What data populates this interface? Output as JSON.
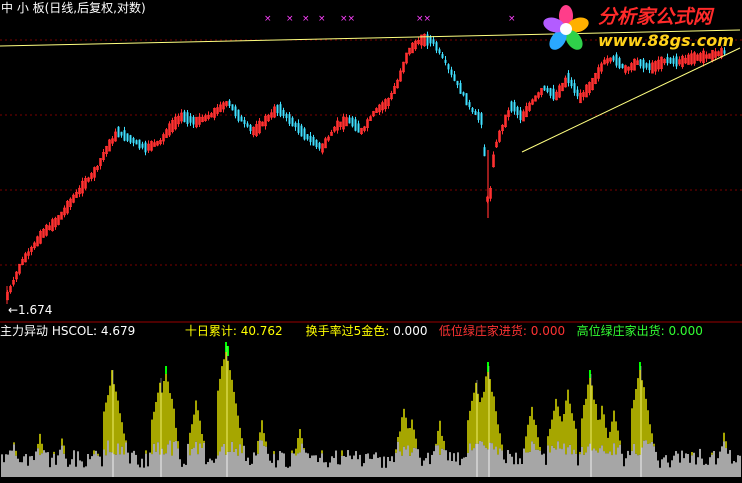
{
  "header": {
    "title": "中 小 板(日线,后复权,对数)"
  },
  "price_panel": {
    "low_label": "←1.674",
    "top_markers": [
      "×",
      "×",
      "×",
      "×",
      "××",
      "××",
      "×"
    ]
  },
  "indicator_panel": {
    "name": "主力异动",
    "items": [
      {
        "label": "HSCOL:",
        "value": "4.679",
        "color": "#ffffff"
      },
      {
        "label": "十日累计:",
        "value": "40.762",
        "color": "#ffff00"
      },
      {
        "label": "换手率过5金色:",
        "value": "0.000",
        "color": "#ffff00"
      },
      {
        "label": "低位绿庄家进货:",
        "value": "0.000",
        "color": "#ff3333"
      },
      {
        "label": "高位绿庄家出货:",
        "value": "0.000",
        "color": "#33ff33"
      }
    ]
  },
  "logo": {
    "line1": "分析家公式网",
    "line2": "www.88gs.com"
  },
  "colors": {
    "up": "#ff3030",
    "down": "#40e0ff",
    "grid": "#7a0000",
    "trendline": "#ffff80",
    "yellow_bar": "#ffff00",
    "green_bar": "#00ff00",
    "white_bar": "#ffffff",
    "marker": "#ff40ff"
  }
}
